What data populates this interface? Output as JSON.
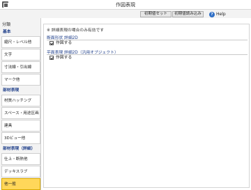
{
  "window": {
    "title": "作図表現",
    "icon": "app-icon"
  },
  "toolbar": {
    "init_set_label": "初期値セット",
    "init_read_label": "初期値読み込み",
    "help_label": "Help",
    "help_icon": "help-icon"
  },
  "sidebar": {
    "header": "分類",
    "groups": [
      {
        "label": "基本",
        "items": [
          "縮尺・レベル他",
          "文字",
          "寸法線・引出線",
          "マーク他"
        ]
      },
      {
        "label": "部材表現",
        "items": [
          "材質ハッチング",
          "スペース・用途区画",
          "建具",
          "3Dビュー他"
        ]
      },
      {
        "label": "部材表現（詳細）",
        "items": [
          "仕上・断熱他",
          "デッキスラブ"
        ]
      }
    ],
    "selected_item": "他一般",
    "accent_color": "#ffd75a",
    "category_color": "#1f3f8a"
  },
  "main": {
    "note": "※ 詳細表現の場合のみ有効です",
    "groups": [
      {
        "title": "断面形状 詳細2D",
        "checkbox_label": "作図する",
        "checked": true
      },
      {
        "title": "平面表現 詳細2D（汎用オブジェクト）",
        "checkbox_label": "作図する",
        "checked": true
      }
    ]
  }
}
